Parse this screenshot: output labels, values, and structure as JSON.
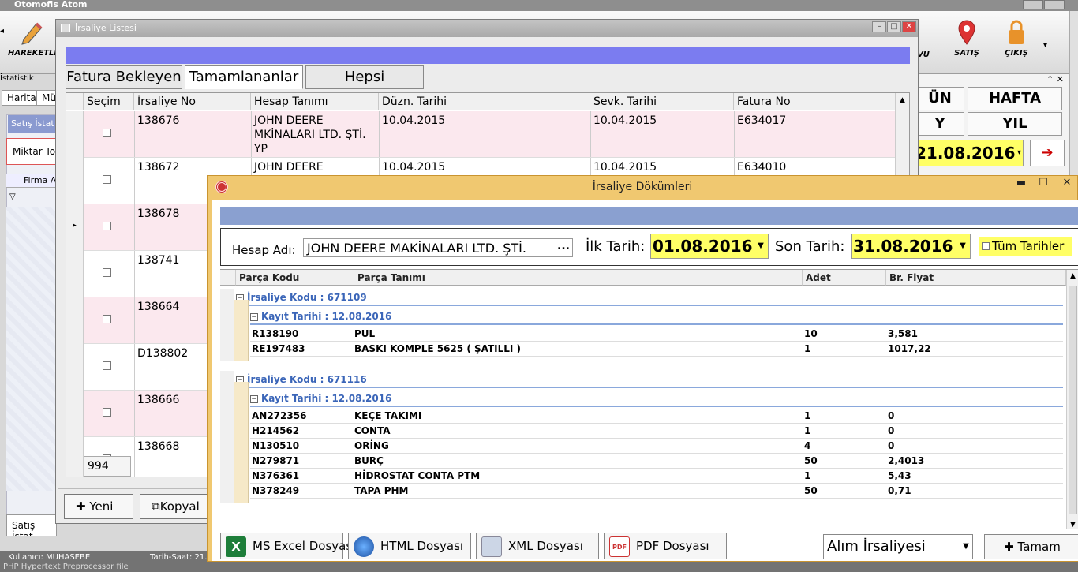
{
  "main": {
    "title": "Otomofis Atom",
    "toolbar": {
      "hareketler": "HAREKETLE",
      "randevu": "VU",
      "satis": "SATIŞ",
      "cikis": "ÇIKIŞ"
    },
    "statistik_label": "İstatistik",
    "tabs": [
      "Harita",
      "Mü"
    ],
    "panel_head": "Satış İstat",
    "miktar": "Miktar To",
    "firma": "Firma A",
    "bottom_tab": "Satış İstat",
    "status": {
      "user": "Kullanıcı: MUHASEBE",
      "datetime": "Tarih-Saat: 21.",
      "bottom_text": "PHP Hypertext Preprocessor file"
    },
    "right_panel": {
      "un": "ÜN",
      "hafta": "HAFTA",
      "y": "Y",
      "yil": "YIL",
      "date": "21.08.2016"
    }
  },
  "list_window": {
    "title": "İrsaliye Listesi",
    "tabs": [
      "Fatura Bekleyen",
      "Tamamlananlar",
      "Hepsi"
    ],
    "columns": [
      "Seçim",
      "İrsaliye No",
      "Hesap Tanımı",
      "Düzn. Tarihi",
      "Sevk. Tarihi",
      "Fatura No"
    ],
    "rows": [
      {
        "no": "138676",
        "hesap": "JOHN DEERE\nMKİNALARI LTD. ŞTİ.\nYP",
        "duzn": "10.04.2015",
        "sevk": "10.04.2015",
        "fatura": "E634017"
      },
      {
        "no": "138672",
        "hesap": "JOHN DEERE",
        "duzn": "10.04.2015",
        "sevk": "10.04.2015",
        "fatura": "E634010"
      },
      {
        "no": "138678",
        "hesap": "",
        "duzn": "",
        "sevk": "",
        "fatura": ""
      },
      {
        "no": "138741",
        "hesap": "",
        "duzn": "",
        "sevk": "",
        "fatura": ""
      },
      {
        "no": "138664",
        "hesap": "",
        "duzn": "",
        "sevk": "",
        "fatura": ""
      },
      {
        "no": "D138802",
        "hesap": "",
        "duzn": "",
        "sevk": "",
        "fatura": ""
      },
      {
        "no": "138666",
        "hesap": "",
        "duzn": "",
        "sevk": "",
        "fatura": ""
      },
      {
        "no": "138668",
        "hesap": "",
        "duzn": "",
        "sevk": "",
        "fatura": ""
      }
    ],
    "count": "994",
    "buttons": {
      "yeni": "Yeni",
      "kopyala": "Kopyal"
    }
  },
  "dok_window": {
    "title": "İrsaliye Dökümleri",
    "filter": {
      "hesap_label": "Hesap Adı:",
      "hesap_value": "JOHN DEERE MAKİNALARI LTD. ŞTİ.",
      "hesap_dots": "...",
      "ilk_label": "İlk Tarih:",
      "ilk_value": "01.08.2016",
      "son_label": "Son Tarih:",
      "son_value": "31.08.2016 2",
      "tum_label": "Tüm Tarihler"
    },
    "columns": [
      "Parça Kodu",
      "Parça Tanımı",
      "Adet",
      "Br. Fiyat"
    ],
    "groups": [
      {
        "irsaliye": "İrsaliye Kodu : 671109",
        "kayit": "Kayıt Tarihi : 12.08.2016",
        "rows": [
          {
            "kod": "R138190",
            "tanim": "PUL",
            "adet": "10",
            "fiyat": "3,581"
          },
          {
            "kod": "RE197483",
            "tanim": "BASKI KOMPLE 5625 ( ŞATILLI )",
            "adet": "1",
            "fiyat": "1017,22"
          }
        ]
      },
      {
        "irsaliye": "İrsaliye Kodu : 671116",
        "kayit": "Kayıt Tarihi : 12.08.2016",
        "rows": [
          {
            "kod": "AN272356",
            "tanim": "KEÇE TAKIMI",
            "adet": "1",
            "fiyat": "0"
          },
          {
            "kod": "H214562",
            "tanim": "CONTA",
            "adet": "1",
            "fiyat": "0"
          },
          {
            "kod": "N130510",
            "tanim": "ORİNG",
            "adet": "4",
            "fiyat": "0"
          },
          {
            "kod": "N279871",
            "tanim": "BURÇ",
            "adet": "50",
            "fiyat": "2,4013"
          },
          {
            "kod": "N376361",
            "tanim": "HİDROSTAT CONTA PTM",
            "adet": "1",
            "fiyat": "5,43"
          },
          {
            "kod": "N378249",
            "tanim": "TAPA PHM",
            "adet": "50",
            "fiyat": "0,71"
          }
        ]
      }
    ],
    "buttons": {
      "excel": "MS Excel Dosyası",
      "html": "HTML Dosyası",
      "xml": "XML Dosyası",
      "pdf": "PDF Dosyası",
      "alim": "Alım İrsaliyesi",
      "tamam": "Tamam"
    }
  }
}
